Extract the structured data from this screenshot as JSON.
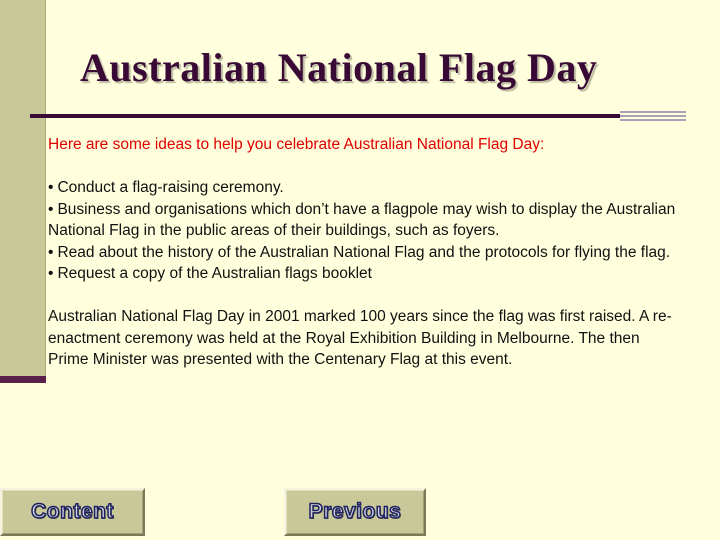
{
  "slide": {
    "title": "Australian National Flag Day",
    "intro": "Here are some ideas to help you celebrate Australian National Flag Day:",
    "bullets": [
      "Conduct a flag-raising ceremony.",
      "Business and organisations which don’t have a flagpole may wish to display the Australian National Flag in the public areas of their buildings, such as foyers.",
      "Read about the history of the Australian National Flag and the protocols for flying the flag.",
      "Request a copy of the Australian flags booklet"
    ],
    "bullet_char": "•",
    "closing": "Australian National Flag Day in 2001 marked 100 years since the flag was first raised. A re-enactment ceremony was held at the Royal Exhibition Building in Melbourne. The then Prime Minister was presented with the Centenary Flag at this event."
  },
  "nav": {
    "content_label": "Content",
    "previous_label": "Previous"
  },
  "colors": {
    "background": "#FFFFDD",
    "title": "#3A0A36",
    "intro_text": "#E00000",
    "sidebar": "#C8C898"
  }
}
